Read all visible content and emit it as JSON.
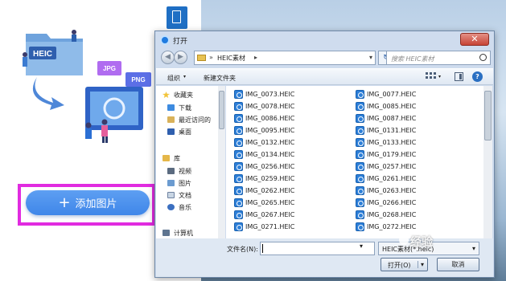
{
  "app": {
    "heic_tag": "HEIC",
    "jpg_tag": "JPG",
    "png_tag": "PNG",
    "add_button_plus": "+",
    "add_button_label": "添加图片",
    "highlight_color": "#e12be0",
    "accent_color": "#3f86e9"
  },
  "dialog": {
    "title": "打开",
    "close_label": "✕",
    "address": {
      "separator": "»",
      "folder": "HEIC素材",
      "separator2": "▸",
      "dropdown": "▾"
    },
    "refresh_icon": "↻",
    "search_placeholder": "搜索 HEIC素材",
    "toolbar": {
      "organize": "组织",
      "organize_arrow": "▾",
      "new_folder": "新建文件夹",
      "view_arrow": "▾",
      "help": "?"
    },
    "nav": {
      "favorites": "收藏夹",
      "downloads": "下载",
      "recent": "最近访问的",
      "desktop": "桌面",
      "libraries": "库",
      "videos": "视频",
      "pictures": "图片",
      "documents": "文档",
      "music": "音乐",
      "computer": "计算机"
    },
    "files": [
      "IMG_0073.HEIC",
      "IMG_0078.HEIC",
      "IMG_0086.HEIC",
      "IMG_0095.HEIC",
      "IMG_0132.HEIC",
      "IMG_0134.HEIC",
      "IMG_0256.HEIC",
      "IMG_0259.HEIC",
      "IMG_0262.HEIC",
      "IMG_0265.HEIC",
      "IMG_0267.HEIC",
      "IMG_0271.HEIC",
      "IMG_0077.HEIC",
      "IMG_0085.HEIC",
      "IMG_0087.HEIC",
      "IMG_0131.HEIC",
      "IMG_0133.HEIC",
      "IMG_0179.HEIC",
      "IMG_0257.HEIC",
      "IMG_0261.HEIC",
      "IMG_0263.HEIC",
      "IMG_0266.HEIC",
      "IMG_0268.HEIC",
      "IMG_0272.HEIC"
    ],
    "filename_label": "文件名(N):",
    "filename_value": "",
    "filename_drop": "▾",
    "filetype": "HEIC素材(*.heic)",
    "filetype_arrow": "▾",
    "open_label": "打开(O)",
    "open_arrow": "▾",
    "cancel_label": "取消"
  },
  "watermark": "经验"
}
